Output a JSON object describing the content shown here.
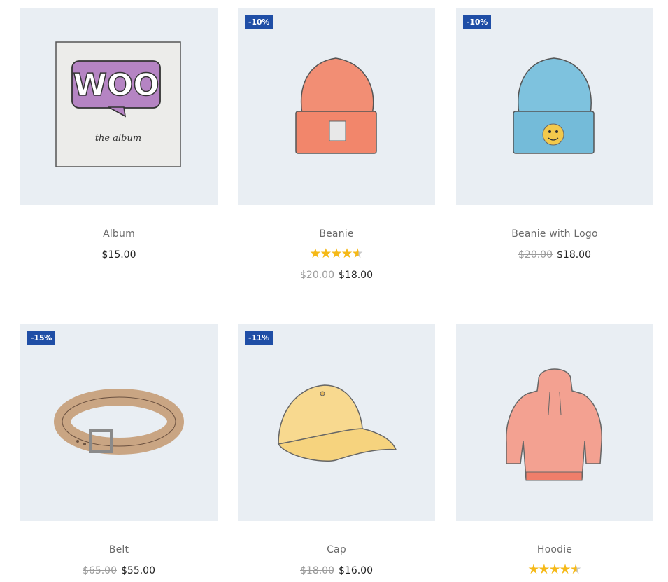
{
  "products": [
    {
      "name": "Album",
      "badge": "",
      "rating": "",
      "regular_price": "",
      "price": "$15.00",
      "illustration": "woo-album-image"
    },
    {
      "name": "Beanie",
      "badge": "-10%",
      "rating": 4.5,
      "regular_price": "$20.00",
      "price": "$18.00",
      "illustration": "orange-beanie-image"
    },
    {
      "name": "Beanie with Logo",
      "badge": "-10%",
      "rating": "",
      "regular_price": "$20.00",
      "price": "$18.00",
      "illustration": "blue-beanie-image"
    },
    {
      "name": "Belt",
      "badge": "-15%",
      "rating": "",
      "regular_price": "$65.00",
      "price": "$55.00",
      "illustration": "leather-belt-image"
    },
    {
      "name": "Cap",
      "badge": "-11%",
      "rating": "",
      "regular_price": "$18.00",
      "price": "$16.00",
      "illustration": "yellow-cap-image"
    },
    {
      "name": "Hoodie",
      "badge": "",
      "rating": 4.5,
      "regular_price": "",
      "price": "",
      "illustration": "pink-hoodie-image"
    }
  ],
  "album_art": {
    "logo": "WOO",
    "caption": "the   album"
  },
  "colors": {
    "badge": "#1f4ea6",
    "star": "#f5b918",
    "thumb_bg": "#e9eef3"
  }
}
